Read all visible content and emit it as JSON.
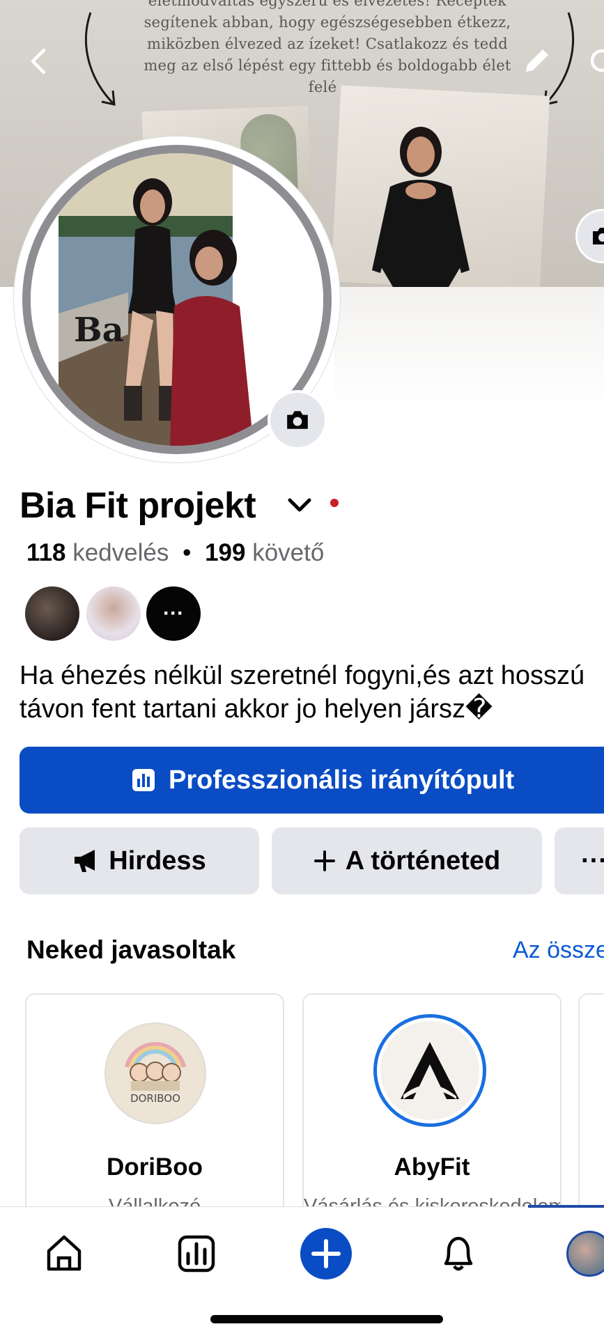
{
  "cover": {
    "text": "életmódváltás egyszerű és élvezetes! Receptek segítenek abban, hogy egészségesebben étkezz, miközben élvezed az ízeket! Csatlakozz és tedd meg az első lépést egy fittebb és boldogabb élet felé ."
  },
  "profile": {
    "name": "Bia Fit projekt",
    "likes_count": "118",
    "likes_label": "kedvelés",
    "separator": "•",
    "followers_count": "199",
    "followers_label": "követő",
    "more_friends": "···",
    "bio_line1": "Ha éhezés nélkül szeretnél fogyni,és azt hosszú",
    "bio_line2": "távon fent tartani akkor jo helyen jársz�",
    "logo_text": "Ba"
  },
  "actions": {
    "pro_dashboard": "Professzionális irányítópult",
    "advertise": "Hirdess",
    "story": "A történeted",
    "more": "···"
  },
  "suggested": {
    "title": "Neked javasoltak",
    "see_all": "Az összes",
    "cards": [
      {
        "name": "DoriBoo",
        "category": "Vállalkozó",
        "logo_text": "DORIBOO"
      },
      {
        "name": "AbyFit",
        "category": "Vásárlás és kiskereskedelem"
      }
    ]
  },
  "tabbar": {
    "items": [
      "home-icon",
      "dashboard-icon",
      "create-icon",
      "notifications-icon",
      "profile-icon"
    ],
    "accent": "#0a4cc4"
  },
  "colors": {
    "primary_button": "#0a4cc4",
    "link": "#0a5ad4",
    "secondary_button": "#e4e6eb",
    "status_dot": "#c8202b"
  }
}
